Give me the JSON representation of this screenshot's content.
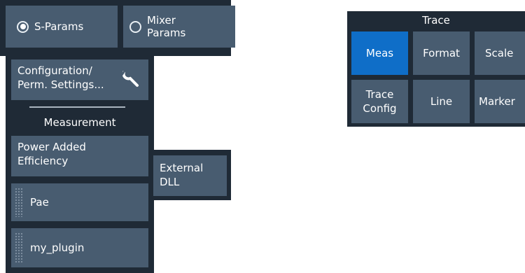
{
  "mode_selector": {
    "options": [
      {
        "label": "S-Params",
        "selected": true
      },
      {
        "label": "Mixer\nParams",
        "selected": false
      }
    ]
  },
  "config_panel": {
    "config_button_label": "Configuration/\nPerm. Settings...",
    "config_icon": "wrench-icon",
    "section_title": "Measurement",
    "items": [
      {
        "label": "Power Added\nEfficiency"
      },
      {
        "label": "Pae"
      },
      {
        "label": "my_plugin"
      }
    ],
    "external_dll_label": "External\nDLL"
  },
  "trace_panel": {
    "title": "Trace",
    "buttons": [
      {
        "label": "Meas",
        "active": true
      },
      {
        "label": "Format",
        "active": false
      },
      {
        "label": "Scale",
        "active": false
      },
      {
        "label": "Trace\nConfig",
        "active": false
      },
      {
        "label": "Line",
        "active": false
      },
      {
        "label": "Marker",
        "active": false
      }
    ]
  },
  "colors": {
    "panel_background": "#1f2a36",
    "button_background": "#485c70",
    "active_button": "#0f6ec8",
    "text": "#ffffff"
  }
}
